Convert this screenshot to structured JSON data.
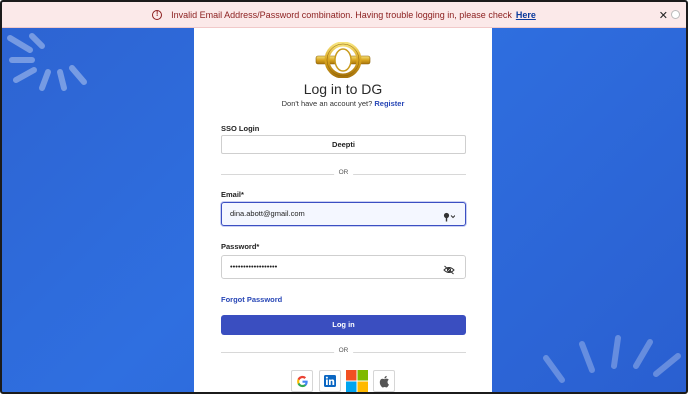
{
  "banner": {
    "message": "Invalid Email Address/Password combination. Having trouble logging in, please check",
    "link": "Here",
    "close": "✕"
  },
  "card": {
    "title": "Log in to DG",
    "subtitle_text": "Don't have an account yet?",
    "register_link": "Register",
    "sso_label": "SSO Login",
    "sso_button": "Deepti",
    "or1": "OR",
    "email_label": "Email*",
    "email_value": "dina.abott@gmail.com",
    "password_label": "Password*",
    "password_value": "••••••••••••••••••",
    "forgot_password": "Forgot Password",
    "login_button": "Log in",
    "or2": "OR"
  },
  "social": [
    "google-icon",
    "linkedin-icon",
    "microsoft-icon",
    "apple-icon"
  ],
  "colors": {
    "background": "#2f6fe0",
    "primary_button": "#3a4ec0",
    "link": "#2847b6",
    "error_bg": "#fbe9e9",
    "error_text": "#8b1e1e"
  }
}
